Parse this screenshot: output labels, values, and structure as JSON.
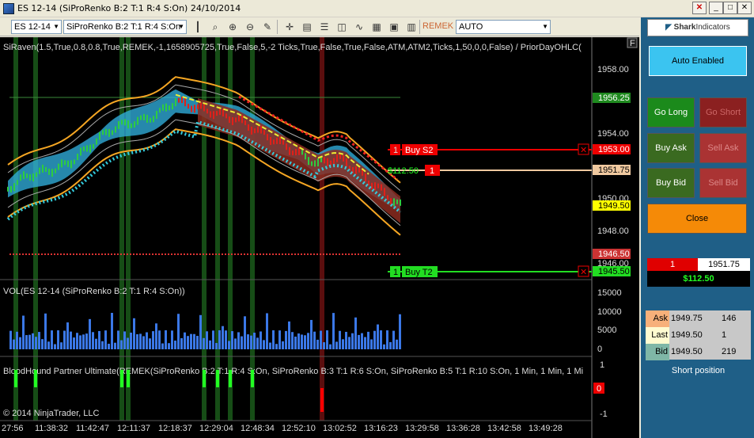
{
  "window": {
    "title": "ES 12-14  (SiProRenko B:2 T:1 R:4 S:On)  24/10/2014",
    "minimize": "_",
    "maximize": "□",
    "close": "✕",
    "panel_close": "✕",
    "panel_restore": "□"
  },
  "toolbar": {
    "instrument": "ES 12-14",
    "bar_type": "SiProRenko B:2 T:1 R:4 S:On",
    "strategy_label": "REMEK",
    "mode_value": "AUTO",
    "icons": [
      "candlestick-icon",
      "magnify-icon",
      "zoom-in-icon",
      "zoom-out-icon",
      "crosshair-icon",
      "pencil-icon",
      "data-box-icon",
      "properties-icon",
      "strategy-icon",
      "indicators-icon",
      "template-icon",
      "save-icon"
    ]
  },
  "chart": {
    "indicator_label": "SiRaven(1.5,True,0.8,0.8,True,REMEK,-1,1658905725,True,False,5,-2 Ticks,True,False,True,False,ATM,ATM2,Ticks,1,50,0,0,False) / PriorDayOHLC(",
    "volume_label": "VOL(ES 12-14 (SiProRenko B:2 T:1 R:4 S:On))",
    "bh_label": "BloodHound Partner Ultimate(REMEK(SiProRenko B:2 T:1 R:4 S:On, SiProRenko B:3 T:1 R:6 S:On, SiProRenko B:5 T:1 R:10 S:On, 1 Min, 1 Min, 1 Mi",
    "copyright": "© 2014 NinjaTrader, LLC",
    "f_button": "F",
    "price_ticks": [
      "1958.00",
      "1956.00",
      "1954.00",
      "1952.00",
      "1950.00",
      "1948.00",
      "1946.00"
    ],
    "volume_ticks": [
      "15000",
      "10000",
      "5000",
      "0"
    ],
    "bh_ticks": [
      "1",
      "0",
      "-1"
    ],
    "time_ticks": [
      "27:56",
      "11:38:32",
      "11:42:47",
      "12:11:37",
      "12:18:37",
      "12:29:04",
      "12:48:34",
      "12:52:10",
      "13:02:52",
      "13:16:23",
      "13:29:58",
      "13:36:28",
      "13:42:58",
      "13:49:28"
    ],
    "price_tags": {
      "high": "1956.25",
      "target1": "1953.00",
      "entry": "1951.75",
      "last": "1949.50",
      "low": "1946.50",
      "target2": "1945.50"
    },
    "order_labels": {
      "sell_qty": "1",
      "sell_name": "Buy S2",
      "pnl": "$112.50",
      "pos_qty": "1",
      "buy_qty": "1",
      "buy_name": "Buy T2",
      "cancel_glyph": "✕"
    },
    "bh_value": "0",
    "colors": {
      "background": "#000000",
      "up_bar": "#2ecc40",
      "down_bar": "#e0201a",
      "envelope": "#f5a623",
      "cloud_bull": "#33b5e5",
      "cloud_bear": "#8b2b20",
      "signal_long": "#1a5a1a",
      "signal_short": "#6b1010"
    }
  },
  "panel": {
    "brand_name": "Shark",
    "brand_suffix": "Indicators",
    "auto_enabled": "Auto Enabled",
    "go_long": "Go Long",
    "go_short": "Go Short",
    "buy_ask": "Buy Ask",
    "sell_ask": "Sell Ask",
    "buy_bid": "Buy Bid",
    "sell_bid": "Sell Bid",
    "close": "Close",
    "position": {
      "qty": "1",
      "price": "1951.75",
      "pnl": "$112.50"
    },
    "quotes": {
      "ask": {
        "label": "Ask",
        "price": "1949.75",
        "size": "146"
      },
      "last": {
        "label": "Last",
        "price": "1949.50",
        "size": "1"
      },
      "bid": {
        "label": "Bid",
        "price": "1949.50",
        "size": "219"
      }
    },
    "status": "Short position"
  }
}
